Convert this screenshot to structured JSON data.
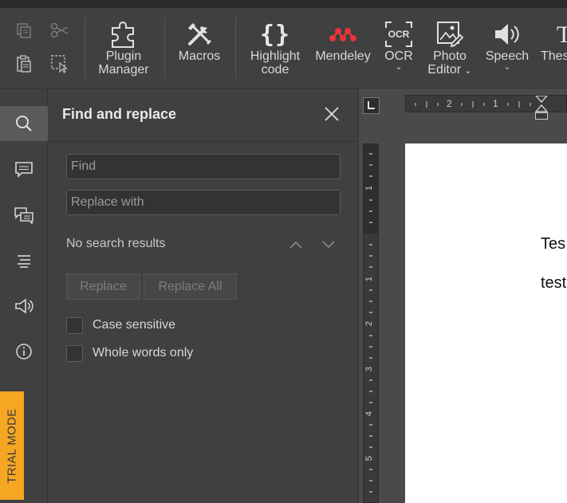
{
  "toolbar": {
    "buttons": [
      {
        "id": "plugin-manager",
        "label_line1": "Plugin",
        "label_line2": "Manager"
      },
      {
        "id": "macros",
        "label_line1": "Macros",
        "label_line2": ""
      },
      {
        "id": "highlight-code",
        "label_line1": "Highlight",
        "label_line2": "code"
      },
      {
        "id": "mendeley",
        "label_line1": "Mendeley",
        "label_line2": ""
      },
      {
        "id": "ocr",
        "label_line1": "OCR",
        "label_line2": ""
      },
      {
        "id": "photo-editor",
        "label_line1": "Photo",
        "label_line2": "Editor"
      },
      {
        "id": "speech",
        "label_line1": "Speech",
        "label_line2": ""
      },
      {
        "id": "thesaurus",
        "label_line1": "Thes",
        "label_line2": ""
      }
    ],
    "ocr_icon_text": "OCR",
    "mendeley_color": "#e8343a"
  },
  "sidebar": {
    "items": [
      "search",
      "comments",
      "chat",
      "headings",
      "announcements",
      "about"
    ],
    "active": "search",
    "trial_label": "TRIAL MODE",
    "trial_color": "#f5a623"
  },
  "find_panel": {
    "title": "Find and replace",
    "find_placeholder": "Find",
    "replace_placeholder": "Replace with",
    "status": "No search results",
    "replace_label": "Replace",
    "replace_all_label": "Replace All",
    "case_sensitive_label": "Case sensitive",
    "whole_words_label": "Whole words only",
    "case_sensitive_checked": false,
    "whole_words_checked": false
  },
  "ruler": {
    "h_labels": [
      "2",
      "1"
    ],
    "v_labels": [
      "1",
      "1",
      "2",
      "3",
      "4",
      "5"
    ]
  },
  "document": {
    "lines": [
      "Tes",
      "test"
    ]
  }
}
